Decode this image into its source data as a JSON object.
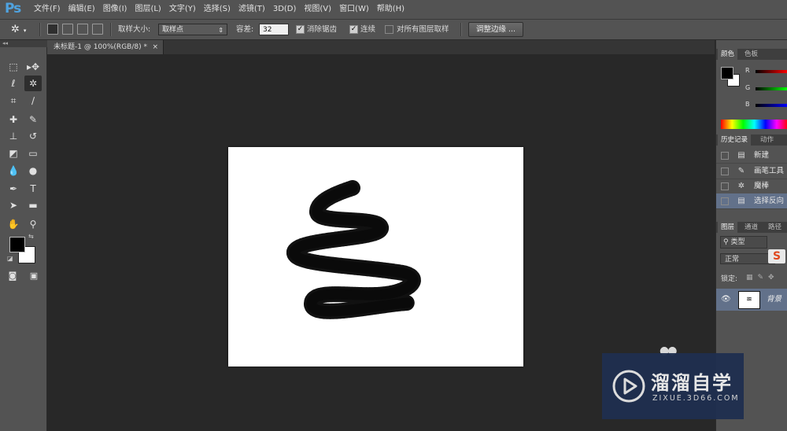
{
  "app": {
    "logo": "Ps"
  },
  "menu": {
    "items": [
      "文件(F)",
      "编辑(E)",
      "图像(I)",
      "图层(L)",
      "文字(Y)",
      "选择(S)",
      "滤镜(T)",
      "3D(D)",
      "视图(V)",
      "窗口(W)",
      "帮助(H)"
    ]
  },
  "options": {
    "sample_size_label": "取样大小:",
    "sample_size_value": "取样点",
    "tolerance_label": "容差:",
    "tolerance_value": "32",
    "antialias_label": "消除锯齿",
    "contiguous_label": "连续",
    "sample_all_label": "对所有图层取样",
    "refine_edge_label": "调整边缘 ..."
  },
  "document": {
    "tab_title": "未标题-1 @ 100%(RGB/8) *",
    "close_glyph": "×"
  },
  "color_panel": {
    "tabs": [
      "颜色",
      "色板"
    ],
    "channels": [
      "R",
      "G",
      "B"
    ],
    "colors": {
      "foreground": "#000000",
      "background": "#ffffff"
    }
  },
  "history_panel": {
    "tabs": [
      "历史记录",
      "动作"
    ],
    "items": [
      {
        "label": "新建",
        "icon": "document-icon"
      },
      {
        "label": "画笔工具",
        "icon": "brush-icon"
      },
      {
        "label": "魔棒",
        "icon": "magic-wand-icon"
      },
      {
        "label": "选择反向",
        "icon": "document-icon"
      }
    ]
  },
  "layers_panel": {
    "tabs": [
      "图层",
      "通道",
      "路径"
    ],
    "filter_label": "类型",
    "blend_mode": "正常",
    "lock_label": "锁定:",
    "layers": [
      {
        "name": "背景"
      }
    ]
  },
  "watermark": {
    "brand": "溜溜自学",
    "url": "ZIXUE.3D66.COM"
  }
}
